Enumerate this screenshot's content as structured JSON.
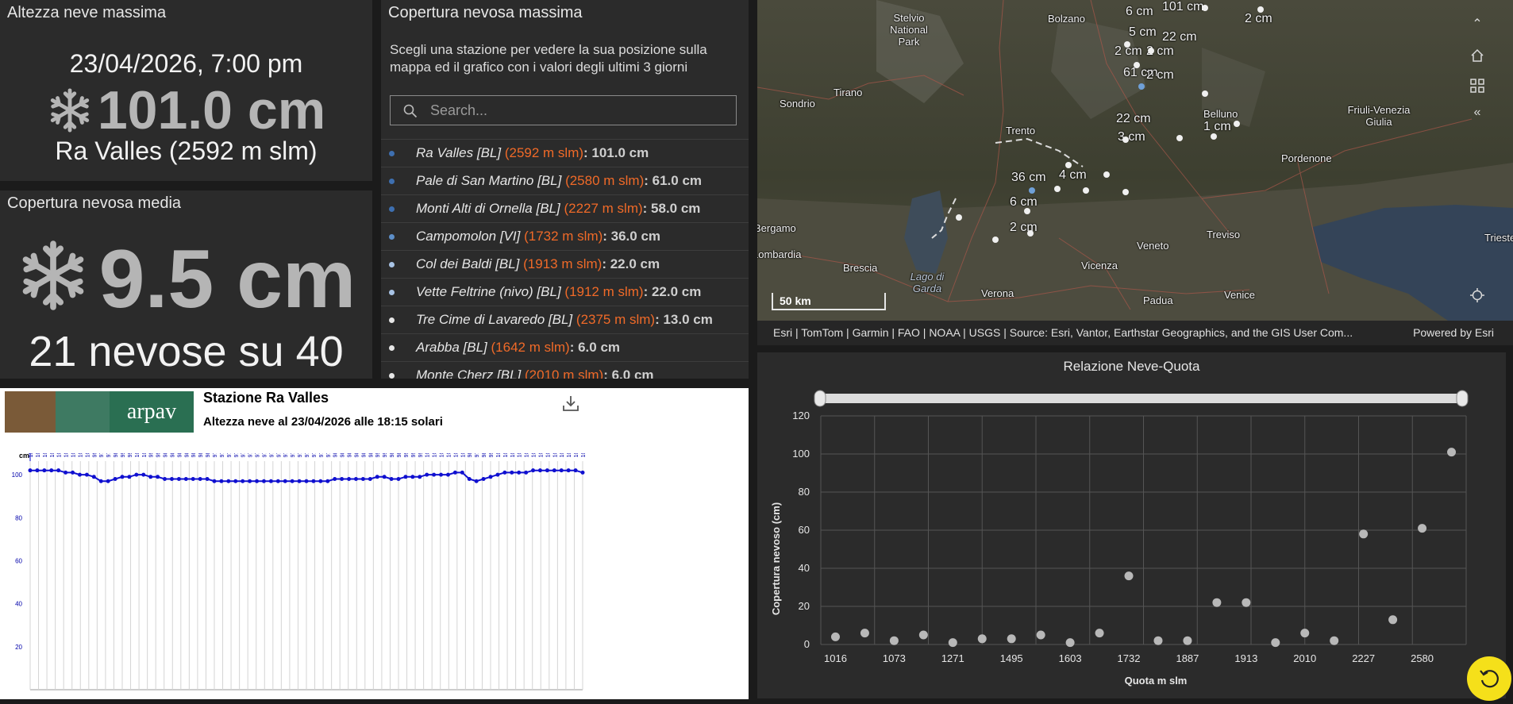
{
  "max_depth": {
    "title": "Altezza neve massima",
    "datetime": "23/04/2026, 7:00 pm",
    "value": "101.0 cm",
    "station": "Ra Valles (2592 m slm)"
  },
  "avg_cover": {
    "title": "Copertura nevosa media",
    "value": "9.5 cm",
    "summary": "21 nevose su 40"
  },
  "station_list": {
    "title": "Copertura nevosa massima",
    "description": "Scegli una stazione per vedere la sua posizione sulla mappa ed il grafico con i valori degli ultimi 3 giorni",
    "search_placeholder": "Search...",
    "items": [
      {
        "name": "Ra Valles [BL]",
        "quota": "(2592 m slm)",
        "value": ": 101.0 cm",
        "dot": "#3e6fb0"
      },
      {
        "name": "Pale di San Martino [BL]",
        "quota": "(2580 m slm)",
        "value": ": 61.0 cm",
        "dot": "#3e6fb0"
      },
      {
        "name": "Monti Alti di Ornella [BL]",
        "quota": "(2227 m slm)",
        "value": ": 58.0 cm",
        "dot": "#3e6fb0"
      },
      {
        "name": "Campomolon [VI]",
        "quota": "(1732 m slm)",
        "value": ": 36.0 cm",
        "dot": "#5d8fc9"
      },
      {
        "name": "Col dei Baldi [BL]",
        "quota": "(1913 m slm)",
        "value": ": 22.0 cm",
        "dot": "#a9c4e6"
      },
      {
        "name": "Vette Feltrine (nivo) [BL]",
        "quota": "(1912 m slm)",
        "value": ": 22.0 cm",
        "dot": "#a9c4e6"
      },
      {
        "name": "Tre Cime di Lavaredo [BL]",
        "quota": "(2375 m slm)",
        "value": ": 13.0 cm",
        "dot": "#e6e6e6"
      },
      {
        "name": "Arabba [BL]",
        "quota": "(1642 m slm)",
        "value": ": 6.0 cm",
        "dot": "#e6e6e6"
      },
      {
        "name": "Monte Cherz [BL]",
        "quota": "(2010 m slm)",
        "value": ": 6.0 cm",
        "dot": "#e6e6e6"
      }
    ]
  },
  "map": {
    "places": [
      "Stelvio National Park",
      "Bolzano",
      "Sondrio",
      "Tirano",
      "Trento",
      "Belluno",
      "Friuli-Venezia Giulia",
      "Pordenone",
      "Bergamo",
      "Lombardia",
      "Brescia",
      "Lago di Garda",
      "Verona",
      "Vicenza",
      "Veneto",
      "Treviso",
      "Padua",
      "Venice",
      "Trieste"
    ],
    "snow_labels": [
      "101 cm",
      "6 cm",
      "2 cm",
      "5 cm",
      "2 cm",
      "22 cm",
      "2 cm",
      "61 cm",
      "2 cm",
      "22 cm",
      "3 cm",
      "1 cm",
      "36 cm",
      "4 cm",
      "6 cm",
      "2 cm"
    ],
    "scale_label": "50 km",
    "attribution": "Esri | TomTom | Garmin | FAO | NOAA | USGS | Source: Esri, Vantor, Earthstar Geographics, and the GIS User Com...",
    "powered_by": "Powered by Esri"
  },
  "scatter": {
    "title": "Relazione Neve-Quota",
    "ylabel": "Copertura nevoso (cm)",
    "xlabel": "Quota m slm"
  },
  "chart_data": [
    {
      "type": "scatter",
      "title": "Relazione Neve-Quota",
      "xlabel": "Quota m slm",
      "ylabel": "Copertura nevoso (cm)",
      "ylim": [
        0,
        120
      ],
      "y_ticks": [
        0,
        20,
        40,
        60,
        80,
        100,
        120
      ],
      "x_tick_labels": [
        "1016",
        "1073",
        "1271",
        "1495",
        "1603",
        "1732",
        "1887",
        "1913",
        "2010",
        "2227",
        "2580"
      ],
      "values": [
        4,
        6,
        2,
        5,
        1,
        3,
        3,
        5,
        1,
        6,
        36,
        2,
        2,
        22,
        22,
        1,
        6,
        2,
        58,
        13,
        61,
        101
      ]
    },
    {
      "type": "line",
      "title": "Stazione Ra Valles",
      "subtitle": "Altezza neve al 23/04/2026 alle 18:15 solari",
      "ylabel": "cm",
      "ylim": [
        0,
        110
      ],
      "y_ticks": [
        20,
        40,
        60,
        80,
        100
      ],
      "x": [
        "00",
        "01",
        "02",
        "03",
        "04",
        "05",
        "06",
        "07",
        "08",
        "09",
        "10",
        "11",
        "12",
        "13",
        "14",
        "15",
        "16",
        "17",
        "18",
        "19",
        "20",
        "21",
        "22",
        "23",
        "00",
        "01",
        "02",
        "03",
        "04",
        "05",
        "06",
        "07",
        "08",
        "09",
        "10",
        "11",
        "12",
        "13",
        "14",
        "15",
        "16",
        "17",
        "18",
        "19",
        "20",
        "21",
        "22",
        "23",
        "00",
        "01",
        "02",
        "03",
        "04",
        "05",
        "06",
        "07",
        "08",
        "09",
        "10",
        "11",
        "12",
        "13",
        "14",
        "15",
        "16",
        "17",
        "18"
      ],
      "date_markers": [
        "21/04",
        "22/04",
        "23/04"
      ],
      "values": [
        102,
        102,
        102,
        102,
        102,
        101,
        101,
        100,
        100,
        99,
        97,
        97,
        98,
        99,
        99,
        100,
        100,
        99,
        99,
        98,
        98,
        98,
        98,
        98,
        98,
        98,
        97,
        97,
        97,
        97,
        97,
        97,
        97,
        97,
        97,
        97,
        97,
        97,
        97,
        97,
        97,
        97,
        97,
        98,
        98,
        98,
        98,
        98,
        98,
        99,
        99,
        98,
        98,
        99,
        99,
        99,
        100,
        100,
        100,
        100,
        101,
        101,
        98,
        97,
        98,
        99,
        100,
        101,
        101,
        101,
        101,
        102,
        102,
        102,
        102,
        102,
        102,
        102,
        101
      ]
    }
  ]
}
